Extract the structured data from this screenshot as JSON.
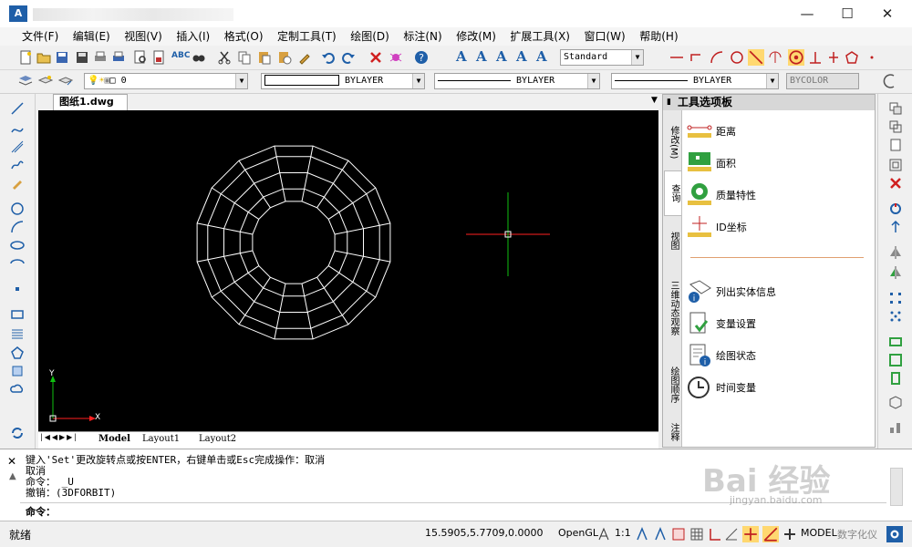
{
  "window": {
    "app_icon_text": "A",
    "minimize": "—",
    "maximize": "☐",
    "close": "✕"
  },
  "menu": [
    "文件(F)",
    "编辑(E)",
    "视图(V)",
    "插入(I)",
    "格式(O)",
    "定制工具(T)",
    "绘图(D)",
    "标注(N)",
    "修改(M)",
    "扩展工具(X)",
    "窗口(W)",
    "帮助(H)"
  ],
  "toolbar": {
    "text_style": "Standard"
  },
  "properties": {
    "layer": "0",
    "color": "BYLAYER",
    "linetype": "BYLAYER",
    "lineweight": "BYLAYER",
    "plot_style": "BYCOLOR"
  },
  "document": {
    "tab": "图纸1.dwg",
    "close": "✕"
  },
  "layouts": [
    "Model",
    "Layout1",
    "Layout2"
  ],
  "ucs": {
    "x": "X",
    "y": "Y"
  },
  "palette": {
    "title": "工具选项板",
    "tabs": [
      "修改(M)",
      "查询",
      "视图",
      "三维动态观察",
      "绘图顺序",
      "注释"
    ],
    "query_items": [
      "距离",
      "面积",
      "质量特性",
      "ID坐标"
    ],
    "info_items": [
      "列出实体信息",
      "变量设置",
      "绘图状态",
      "时间变量"
    ]
  },
  "command": {
    "close": "✕",
    "lines": [
      "键入'Set'更改旋转点或按ENTER，右键单击或Esc完成操作：取消",
      "取消",
      "命令： _U",
      "撤销：(3DFORBIT)"
    ],
    "prompt": "命令："
  },
  "status": {
    "state": "就绪",
    "coords": "15.5905,5.7709,0.0000",
    "renderer": "OpenGL",
    "scale": "1:1",
    "space": "MODEL",
    "digitizer": "数字化仪"
  },
  "watermark": {
    "main": "Bai 经验",
    "sub": "jingyan.baidu.com"
  },
  "colors": {
    "canvas": "#000000",
    "wire": "#ffffff",
    "axis_x": "#ff2020",
    "axis_y": "#10c010"
  }
}
